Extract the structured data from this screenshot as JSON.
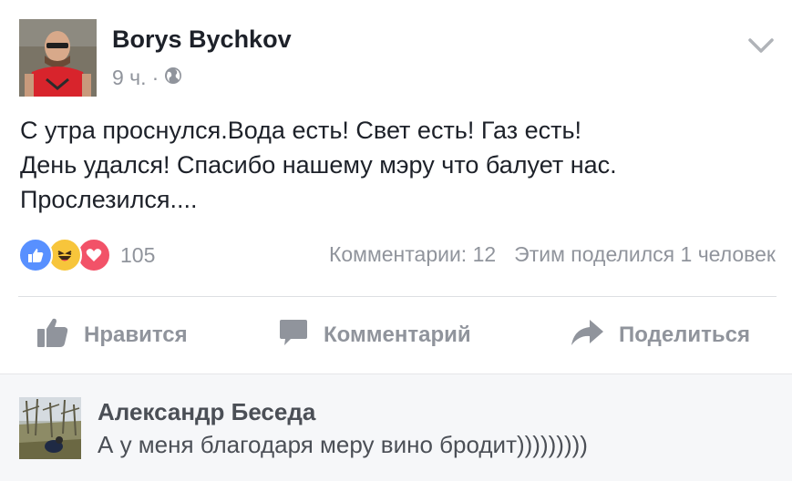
{
  "post": {
    "author": "Borys Bychkov",
    "time": "9 ч.",
    "separator": "·",
    "privacy_icon": "globe-icon",
    "body_lines": [
      "С утра проснулся.Вода есть! Свет есть! Газ есть!",
      "День удался! Спасибо нашему мэру что балует нас.",
      "Прослезился...."
    ],
    "reactions": {
      "icons": [
        "like-reaction-icon",
        "haha-reaction-icon",
        "love-reaction-icon"
      ],
      "count": "105"
    },
    "stats": {
      "comments": "Комментарии: 12",
      "shares": "Этим поделился 1 человек"
    },
    "actions": {
      "like": "Нравится",
      "comment": "Комментарий",
      "share": "Поделиться"
    }
  },
  "comment": {
    "author": "Александр Беседа",
    "text": "А у меня благодаря меру вино бродит)))))))))"
  },
  "colors": {
    "like_blue": "#5890ff",
    "haha_yellow": "#f7c53b",
    "love_red": "#f25268",
    "muted_text": "#90949c",
    "comment_bg": "#f6f7f9"
  }
}
